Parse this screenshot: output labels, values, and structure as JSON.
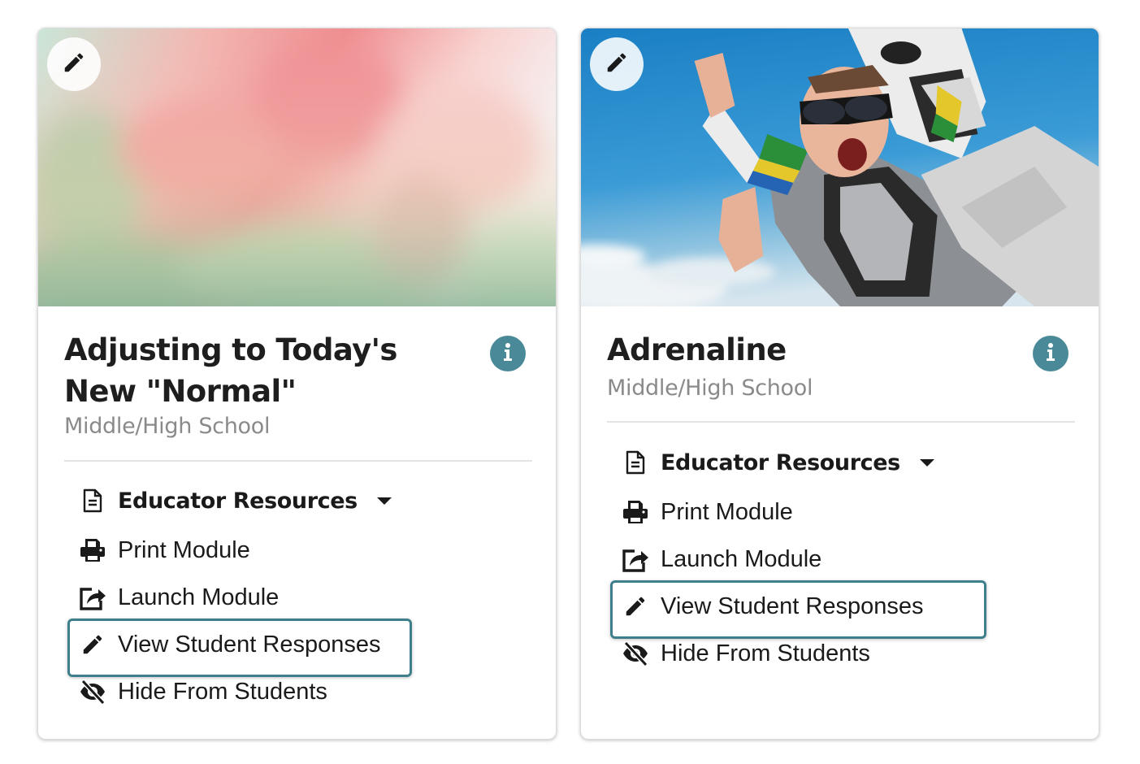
{
  "cards": [
    {
      "title": "Adjusting to Today's New \"Normal\"",
      "level": "Middle/High School",
      "menu": {
        "educator_resources": "Educator Resources",
        "print": "Print Module",
        "launch": "Launch Module",
        "view_responses": "View Student Responses",
        "hide": "Hide From Students"
      }
    },
    {
      "title": "Adrenaline",
      "level": "Middle/High School",
      "menu": {
        "educator_resources": "Educator Resources",
        "print": "Print Module",
        "launch": "Launch Module",
        "view_responses": "View Student Responses",
        "hide": "Hide From Students"
      }
    }
  ],
  "colors": {
    "accent": "#4a8a98",
    "highlight_border": "#3f7f8c",
    "subtitle": "#8a8a8a"
  },
  "icons": {
    "edit": "pencil-icon",
    "info": "info-icon",
    "resources": "document-icon",
    "print": "printer-icon",
    "launch": "external-link-icon",
    "view": "pencil-icon",
    "hide": "eye-slash-icon"
  }
}
